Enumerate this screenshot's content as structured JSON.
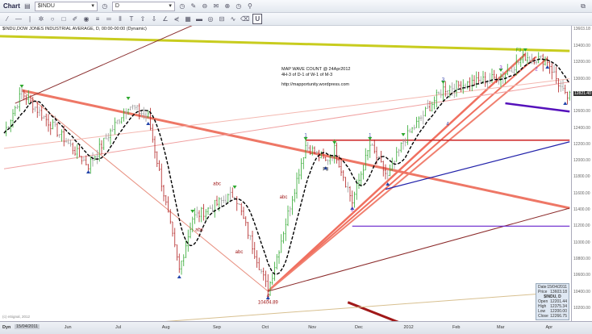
{
  "toolbar": {
    "chart_label": "Chart",
    "symbol": "$INDU",
    "interval": "D",
    "u_button": "U",
    "row1_icons": [
      "refresh-icon",
      "link-icon",
      "clock-icon",
      "message-icon",
      "plus-icon",
      "minus-icon",
      "chain-icon"
    ],
    "row2_icons": [
      "line-icon",
      "hline-icon",
      "vline-icon",
      "fib-icon",
      "ellipse-icon",
      "rect-icon",
      "pencil-icon",
      "circle-icon",
      "channel-icon",
      "equal-icon",
      "bars-icon",
      "text-icon",
      "arrow-up-icon",
      "arrow-down-icon",
      "gann-icon",
      "fan-icon",
      "grid-icon",
      "box-icon",
      "eye-icon",
      "tag-icon",
      "wave-icon",
      "eraser-icon"
    ]
  },
  "chart_title": "$INDU,DOW JONES INDUSTRIAL AVERAGE, D, 00:00-00:00 (Dynamic)",
  "annotation": {
    "line1": "MAP WAVE COUNT @ 24Apr2012",
    "line2": "4H-3 of D-1 of W-1 of M-3",
    "url": "http://mapportunity.wordpress.com"
  },
  "copyright": "(c) eSignal, 2012",
  "date_field": {
    "label": "Dyn",
    "value": "15/04/2011"
  },
  "data_box": {
    "date_label": "Date",
    "date": "15/04/2011",
    "price_label": "Price",
    "price": "13603.18",
    "symbol": "$INDU, D",
    "open_label": "Open",
    "open": "12201.44",
    "high_label": "High",
    "high": "12375.34",
    "low_label": "Low",
    "low": "12200.00",
    "close_label": "Close",
    "close": "12266.75"
  },
  "colors": {
    "up": "#2ea82e",
    "down": "#b22222",
    "neutral": "#999999",
    "ma": "#000000",
    "accent": "#1a4fa0"
  },
  "chart_data": {
    "type": "candlestick",
    "title": "$INDU,DOW JONES INDUSTRIAL AVERAGE, D",
    "ylim": [
      10100,
      13700
    ],
    "y_ticks": [
      13400,
      13200,
      13000,
      12800,
      12600,
      12400,
      12200,
      12000,
      11800,
      11600,
      11400,
      11200,
      11000,
      10800,
      10600,
      10400,
      10200
    ],
    "y_top_label": "13603.18",
    "y_current_label": "12821.40",
    "current_value": 12821.4,
    "x_ticks": [
      {
        "label": "Jun",
        "bar": 29
      },
      {
        "label": "Jul",
        "bar": 52
      },
      {
        "label": "Aug",
        "bar": 73
      },
      {
        "label": "Sep",
        "bar": 96
      },
      {
        "label": "Oct",
        "bar": 118
      },
      {
        "label": "Nov",
        "bar": 139
      },
      {
        "label": "Dec",
        "bar": 160
      },
      {
        "label": "2012",
        "bar": 182
      },
      {
        "label": "Feb",
        "bar": 204
      },
      {
        "label": "Mar",
        "bar": 224
      },
      {
        "label": "Apr",
        "bar": 246
      }
    ],
    "bars": 255,
    "pivots": [
      [
        0,
        12336
      ],
      [
        8,
        12829
      ],
      [
        38,
        11942
      ],
      [
        56,
        12681
      ],
      [
        65,
        12533
      ],
      [
        79,
        10661
      ],
      [
        85,
        11301
      ],
      [
        104,
        11597
      ],
      [
        119,
        10405
      ],
      [
        136,
        12188
      ],
      [
        145,
        11990
      ],
      [
        149,
        12139
      ],
      [
        157,
        11498
      ],
      [
        165,
        12188
      ],
      [
        173,
        11794
      ],
      [
        180,
        12237
      ],
      [
        198,
        12878
      ],
      [
        224,
        13026
      ],
      [
        235,
        13272
      ],
      [
        245,
        13223
      ],
      [
        253,
        12779
      ]
    ],
    "trendlines": [
      {
        "from": [
          -2,
          13520
        ],
        "to": [
          255,
          13340
        ],
        "color": "#c8cc1e",
        "width": 3
      },
      {
        "from": [
          8,
          12858
        ],
        "to": [
          255,
          11420
        ],
        "color": "#ee7766",
        "width": 3
      },
      {
        "from": [
          119,
          10405
        ],
        "to": [
          235,
          13300
        ],
        "color": "#f07060",
        "width": 2.5
      },
      {
        "from": [
          119,
          10405
        ],
        "to": [
          240,
          13270
        ],
        "color": "#f07060",
        "width": 2
      },
      {
        "from": [
          119,
          10405
        ],
        "to": [
          245,
          13250
        ],
        "color": "#f08070",
        "width": 2
      },
      {
        "from": [
          119,
          10405
        ],
        "to": [
          255,
          11420
        ],
        "color": "#8b2a2a",
        "width": 1
      },
      {
        "from": [
          155,
          10270
        ],
        "to": [
          185,
          9950
        ],
        "color": "#a01818",
        "width": 3
      },
      {
        "from": [
          5,
          12700
        ],
        "to": [
          110,
          13950
        ],
        "color": "#8b3030",
        "width": 1
      },
      {
        "from": [
          8,
          12858
        ],
        "to": [
          119,
          10405
        ],
        "color": "#e89080",
        "width": 1
      },
      {
        "from": [
          172,
          11650
        ],
        "to": [
          255,
          12230
        ],
        "color": "#2222aa",
        "width": 1.2
      },
      {
        "from": [
          136,
          12250
        ],
        "to": [
          255,
          12250
        ],
        "color": "#cc2222",
        "width": 1.5
      },
      {
        "from": [
          157,
          11200
        ],
        "to": [
          255,
          11200
        ],
        "color": "#6622cc",
        "width": 1.2
      },
      {
        "from": [
          226,
          12700
        ],
        "to": [
          255,
          12600
        ],
        "color": "#5511bb",
        "width": 2.5
      },
      {
        "from": [
          0,
          11900
        ],
        "to": [
          255,
          12960
        ],
        "color": "#f0a0a0",
        "width": 1
      },
      {
        "from": [
          0,
          12150
        ],
        "to": [
          255,
          13000
        ],
        "color": "#f4b8b0",
        "width": 1
      },
      {
        "from": [
          70,
          10030
        ],
        "to": [
          255,
          10400
        ],
        "color": "#d8c090",
        "width": 1
      }
    ],
    "wave_labels": [
      {
        "text": "4",
        "bar": 119,
        "value": 10330,
        "color": "#a01818"
      },
      {
        "text": "10404.89",
        "bar": 119,
        "value": 10250,
        "color": "#a01818"
      },
      {
        "text": "2",
        "bar": 157,
        "value": 11380,
        "color": "#8833cc"
      },
      {
        "text": "F3",
        "bar": 145,
        "value": 11880,
        "color": "#222"
      },
      {
        "text": "1",
        "bar": 136,
        "value": 12290,
        "color": "#3344aa"
      },
      {
        "text": "1",
        "bar": 165,
        "value": 12290,
        "color": "#3344aa"
      },
      {
        "text": "3",
        "bar": 198,
        "value": 12970,
        "color": "#3344aa"
      },
      {
        "text": "3",
        "bar": 224,
        "value": 13120,
        "color": "#8833cc"
      },
      {
        "text": "F3",
        "bar": 232,
        "value": 13330,
        "color": "#2ea82e"
      },
      {
        "text": "2",
        "bar": 240,
        "value": 13100,
        "color": "#8833cc"
      },
      {
        "text": "4",
        "bar": 200,
        "value": 12430,
        "color": "#3344aa"
      },
      {
        "text": "abc",
        "bar": 88,
        "value": 11140,
        "color": "#a01818"
      },
      {
        "text": "abc",
        "bar": 96,
        "value": 11700,
        "color": "#a01818"
      },
      {
        "text": "abc",
        "bar": 106,
        "value": 10870,
        "color": "#a01818"
      },
      {
        "text": "abc",
        "bar": 126,
        "value": 11540,
        "color": "#a01818"
      }
    ]
  }
}
